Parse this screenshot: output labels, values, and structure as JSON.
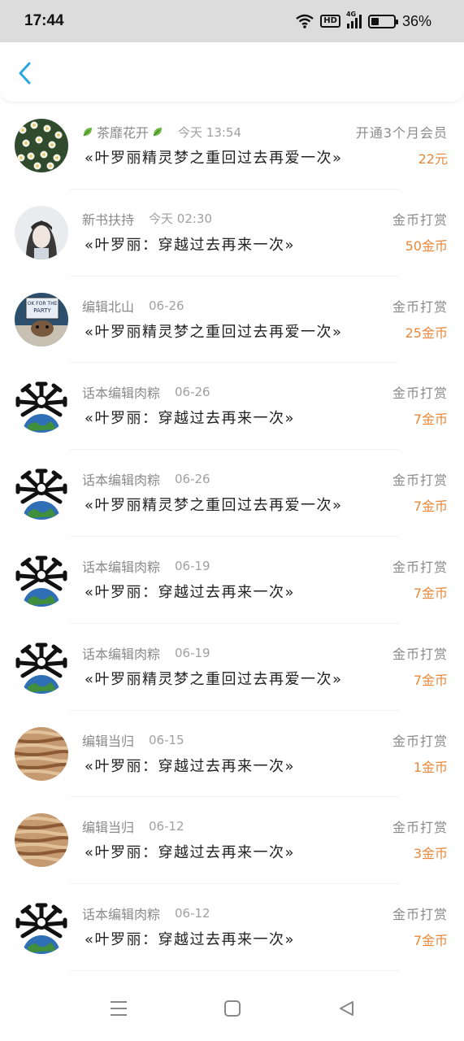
{
  "status_bar": {
    "time": "17:44",
    "battery_pct": "36%",
    "battery_level": 0.36,
    "network_type": "4G",
    "hd_label": "HD"
  },
  "colors": {
    "amount": "#e8883a",
    "accent_back": "#2ba7e0"
  },
  "records": [
    {
      "name": "茶靡花开",
      "time": "今天 13:54",
      "type": "开通3个月会员",
      "title": "«叶罗丽精灵梦之重回过去再爱一次»",
      "amount": "22元",
      "avatar": "flowers",
      "leaves": true
    },
    {
      "name": "新书扶持",
      "time": "今天 02:30",
      "type": "金币打赏",
      "title": "«叶罗丽：穿越过去再来一次»",
      "amount": "50金币",
      "avatar": "portrait"
    },
    {
      "name": "编辑北山",
      "time": "06-26",
      "type": "金币打赏",
      "title": "«叶罗丽精灵梦之重回过去再爱一次»",
      "amount": "25金币",
      "avatar": "party",
      "avatar_text": "OK FOR THE PARTY"
    },
    {
      "name": "话本编辑肉粽",
      "time": "06-26",
      "type": "金币打赏",
      "title": "«叶罗丽：穿越过去再来一次»",
      "amount": "7金币",
      "avatar": "globe"
    },
    {
      "name": "话本编辑肉粽",
      "time": "06-26",
      "type": "金币打赏",
      "title": "«叶罗丽精灵梦之重回过去再爱一次»",
      "amount": "7金币",
      "avatar": "globe"
    },
    {
      "name": "话本编辑肉粽",
      "time": "06-19",
      "type": "金币打赏",
      "title": "«叶罗丽：穿越过去再来一次»",
      "amount": "7金币",
      "avatar": "globe"
    },
    {
      "name": "话本编辑肉粽",
      "time": "06-19",
      "type": "金币打赏",
      "title": "«叶罗丽精灵梦之重回过去再爱一次»",
      "amount": "7金币",
      "avatar": "globe"
    },
    {
      "name": "编辑当归",
      "time": "06-15",
      "type": "金币打赏",
      "title": "«叶罗丽：穿越过去再来一次»",
      "amount": "1金币",
      "avatar": "wood"
    },
    {
      "name": "编辑当归",
      "time": "06-12",
      "type": "金币打赏",
      "title": "«叶罗丽：穿越过去再来一次»",
      "amount": "3金币",
      "avatar": "wood"
    },
    {
      "name": "话本编辑肉粽",
      "time": "06-12",
      "type": "金币打赏",
      "title": "«叶罗丽：穿越过去再来一次»",
      "amount": "7金币",
      "avatar": "globe"
    }
  ],
  "nav": {
    "menu_icon": "menu-icon",
    "home_icon": "home-icon",
    "back_icon": "back-triangle-icon"
  }
}
